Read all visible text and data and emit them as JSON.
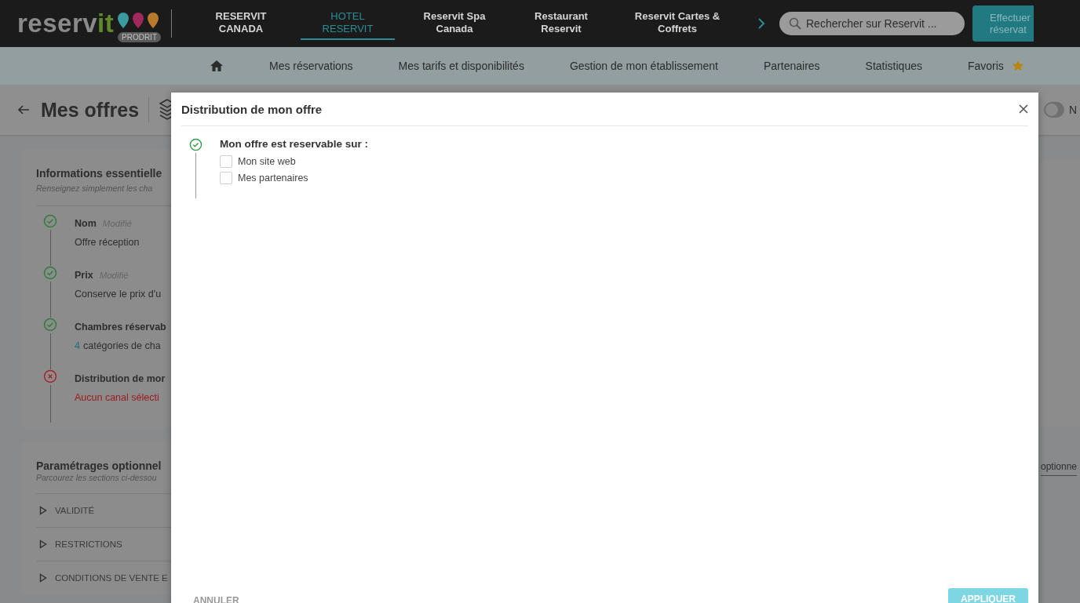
{
  "topbar": {
    "logo": {
      "main": "reserv",
      "accent": "it",
      "badge": "PRODRIT"
    },
    "nav": [
      {
        "label": "RESERVIT CANADA",
        "selected": false
      },
      {
        "label": "HOTEL RESERVIT",
        "selected": true
      },
      {
        "label": "Reservit Spa Canada",
        "selected": false
      },
      {
        "label": "Restaurant Reservit",
        "selected": false
      },
      {
        "label": "Reservit Cartes & Coffrets",
        "selected": false
      }
    ],
    "search": {
      "placeholder": "Rechercher sur Reservit ..."
    },
    "action_button": "Effectuer réservat"
  },
  "subnav": [
    "Mes réservations",
    "Mes tarifs et disponibilités",
    "Gestion de mon établissement",
    "Partenaires",
    "Statistiques",
    "Favoris"
  ],
  "page": {
    "title": "Mes offres",
    "toggle": {
      "on": false,
      "label": "N"
    },
    "essentials": {
      "title": "Informations essentielle",
      "subtitle": "Renseignez simplement les cha",
      "steps": [
        {
          "kind": "ok",
          "title": "Nom",
          "badge": "Modifié",
          "detail": "Offre réception"
        },
        {
          "kind": "ok",
          "title": "Prix",
          "badge": "Modifié",
          "detail": "Conserve le prix d'u"
        },
        {
          "kind": "ok",
          "title": "Chambres réservab",
          "count": "4",
          "detail": "catégories de cha"
        },
        {
          "kind": "error",
          "title": "Distribution de mor",
          "detail": "Aucun canal sélecti"
        }
      ]
    },
    "optional": {
      "title": "Paramétrages optionnel",
      "subtitle": "Parcourez les sections ci-dessou",
      "side_label": "optionne",
      "sections": [
        "VALIDITÉ",
        "RESTRICTIONS",
        "CONDITIONS DE VENTE E"
      ]
    }
  },
  "dialog": {
    "title": "Distribution de mon offre",
    "question": "Mon offre est reservable sur :",
    "options": [
      {
        "label": "Mon site web",
        "checked": false
      },
      {
        "label": "Mes partenaires",
        "checked": false
      }
    ],
    "cancel": "ANNULER",
    "apply": "APPLIQUER"
  }
}
